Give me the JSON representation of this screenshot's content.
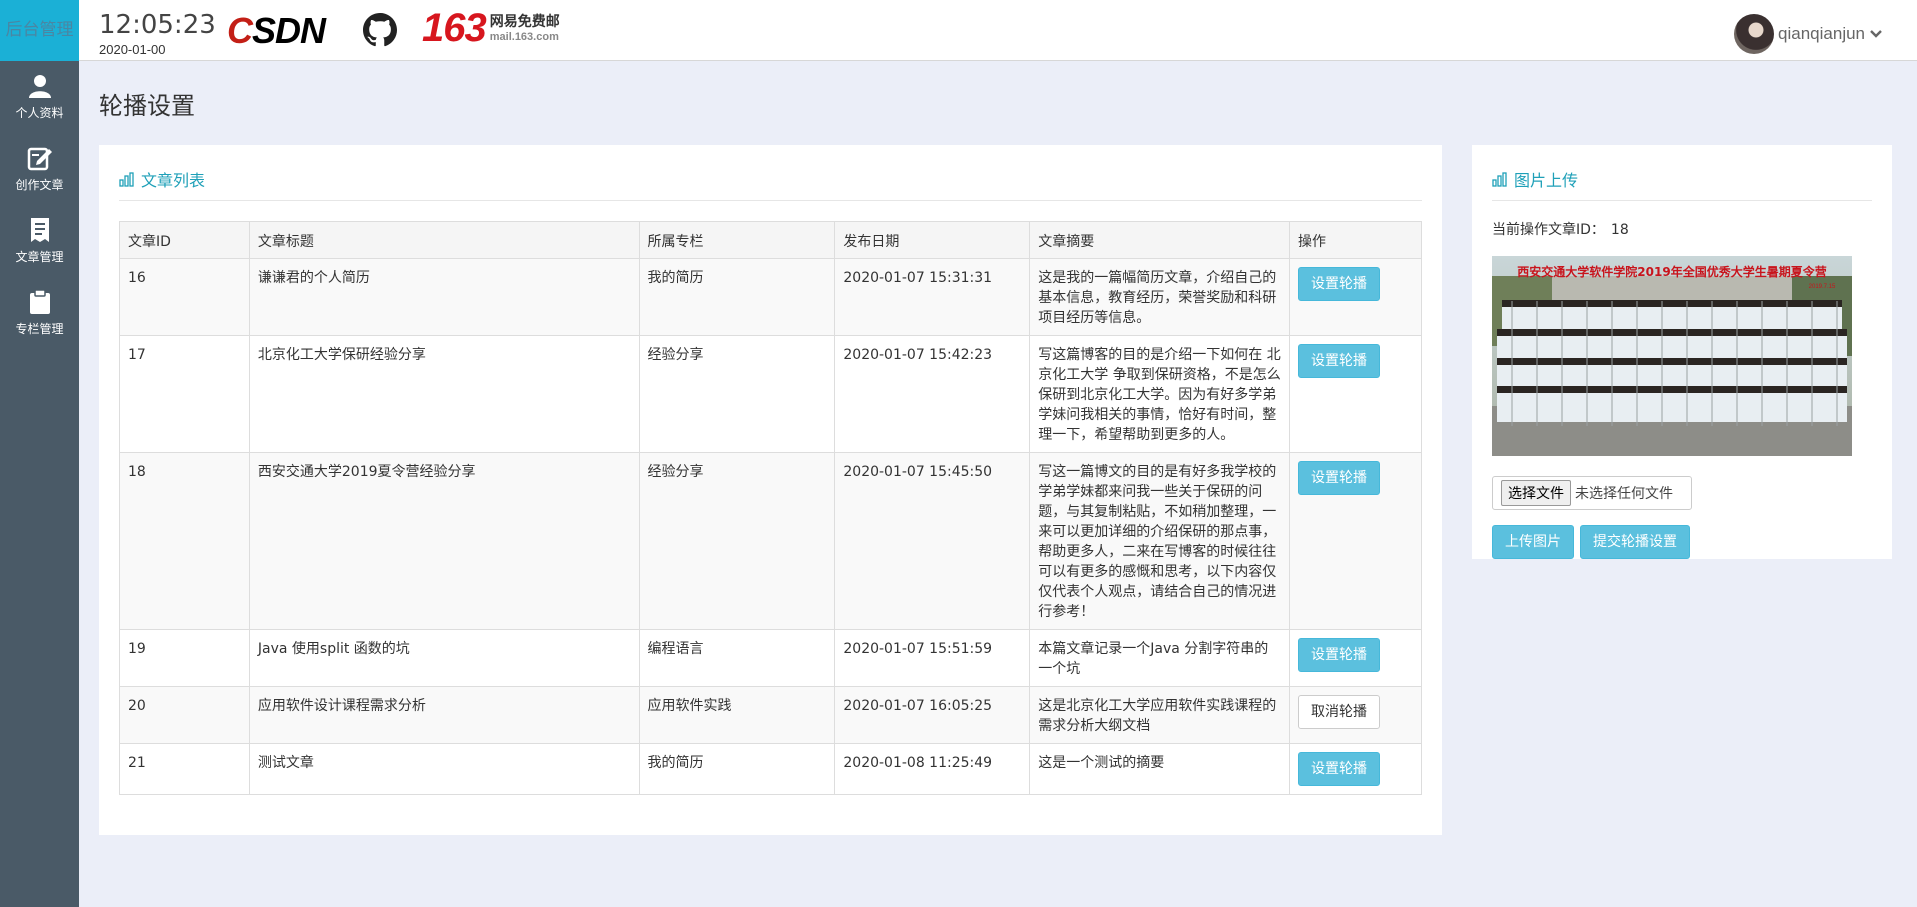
{
  "sidebar": {
    "brand": "后台管理",
    "items": [
      {
        "label": "个人资料",
        "icon": "user-icon"
      },
      {
        "label": "创作文章",
        "icon": "edit-icon"
      },
      {
        "label": "文章管理",
        "icon": "document-icon"
      },
      {
        "label": "专栏管理",
        "icon": "clipboard-icon"
      }
    ]
  },
  "header": {
    "time": "12:05:23",
    "date": "2020-01-00",
    "csdn_logo": {
      "c": "C",
      "rest": "SDN"
    },
    "mail": {
      "num": "163",
      "cn": "网易免费邮",
      "en": "mail.163.com"
    },
    "username": "qianqianjun",
    "accent": "#1bb0d6"
  },
  "page_title": "轮播设置",
  "articles": {
    "heading": "文章列表",
    "columns": [
      "文章ID",
      "文章标题",
      "所属专栏",
      "发布日期",
      "文章摘要",
      "操作"
    ],
    "rows": [
      {
        "id": "16",
        "title": "谦谦君的个人简历",
        "column": "我的简历",
        "date": "2020-01-07 15:31:31",
        "summary": "这是我的一篇幅简历文章，介绍自己的基本信息，教育经历，荣誉奖励和科研项目经历等信息。",
        "action": "设置轮播",
        "action_style": "info"
      },
      {
        "id": "17",
        "title": "北京化工大学保研经验分享",
        "column": "经验分享",
        "date": "2020-01-07 15:42:23",
        "summary": "写这篇博客的目的是介绍一下如何在 北京化工大学 争取到保研资格，不是怎么保研到北京化工大学。因为有好多学弟学妹问我相关的事情，恰好有时间，整理一下，希望帮助到更多的人。",
        "action": "设置轮播",
        "action_style": "info"
      },
      {
        "id": "18",
        "title": "西安交通大学2019夏令营经验分享",
        "column": "经验分享",
        "date": "2020-01-07 15:45:50",
        "summary": "写这一篇博文的目的是有好多我学校的学弟学妹都来问我一些关于保研的问题，与其复制粘贴，不如稍加整理，一来可以更加详细的介绍保研的那点事，帮助更多人，二来在写博客的时候往往可以有更多的感慨和思考，以下内容仅仅代表个人观点，请结合自己的情况进行参考！",
        "action": "设置轮播",
        "action_style": "info"
      },
      {
        "id": "19",
        "title": "Java 使用split 函数的坑",
        "column": "编程语言",
        "date": "2020-01-07 15:51:59",
        "summary": "本篇文章记录一个Java 分割字符串的一个坑",
        "action": "设置轮播",
        "action_style": "info"
      },
      {
        "id": "20",
        "title": "应用软件设计课程需求分析",
        "column": "应用软件实践",
        "date": "2020-01-07 16:05:25",
        "summary": "这是北京化工大学应用软件实践课程的需求分析大纲文档",
        "action": "取消轮播",
        "action_style": "default"
      },
      {
        "id": "21",
        "title": "测试文章",
        "column": "我的简历",
        "date": "2020-01-08 11:25:49",
        "summary": "这是一个测试的摘要",
        "action": "设置轮播",
        "action_style": "info"
      }
    ]
  },
  "upload": {
    "heading": "图片上传",
    "current_label": "当前操作文章ID：",
    "current_id": "18",
    "photo_banner": "西安交通大学软件学院2019年全国优秀大学生暑期夏令营",
    "photo_date": "2019.7.15",
    "file_button": "选择文件",
    "file_status": "未选择任何文件",
    "upload_button": "上传图片",
    "submit_button": "提交轮播设置"
  }
}
